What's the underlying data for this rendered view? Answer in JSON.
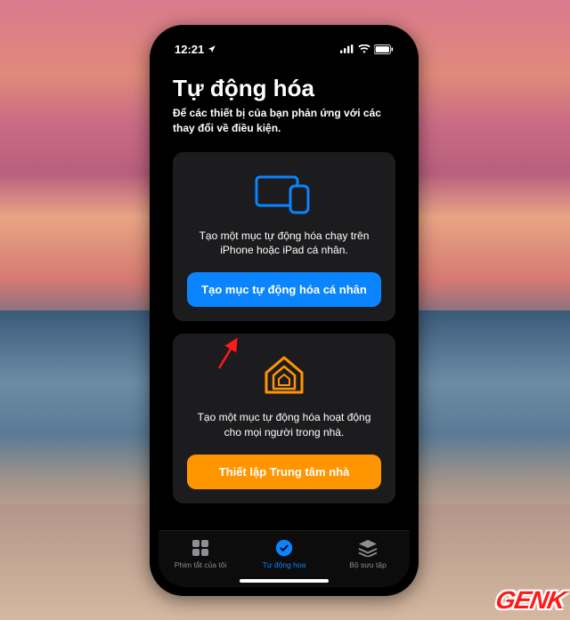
{
  "status_bar": {
    "time": "12:21"
  },
  "page": {
    "title": "Tự động hóa",
    "subtitle": "Để các thiết bị của bạn phản ứng với các thay đổi về điều kiện."
  },
  "cards": {
    "personal": {
      "text": "Tạo một mục tự động hóa chạy trên iPhone hoặc iPad cá nhân.",
      "button": "Tạo mục tự động hóa cá nhân"
    },
    "home": {
      "text": "Tạo một mục tự động hóa hoạt động cho mọi người trong nhà.",
      "button": "Thiết lập Trung tâm nhà"
    }
  },
  "tabs": {
    "shortcuts": "Phim tắt của tôi",
    "automation": "Tự động hoa",
    "gallery": "Bộ sưu tập"
  },
  "watermark": "GENK"
}
